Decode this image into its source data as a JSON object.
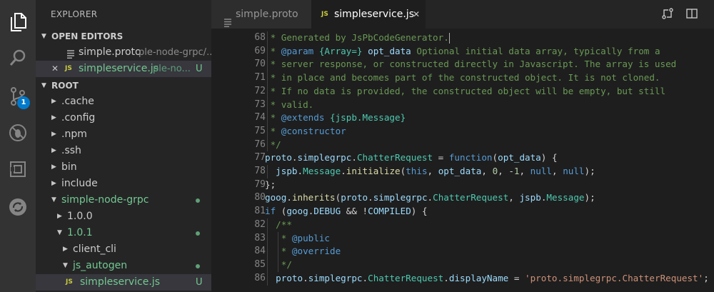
{
  "explorer": {
    "title": "EXPLORER",
    "open_editors": {
      "label": "OPEN EDITORS",
      "items": [
        {
          "name": "simple.proto",
          "path": "ple-node-grpc/..."
        },
        {
          "close": "✕",
          "badge": "JS",
          "name": "simpleservice.js",
          "path": "ple-no...",
          "status": "U"
        }
      ]
    },
    "root": {
      "label": "ROOT",
      "items": [
        {
          "name": ".cache"
        },
        {
          "name": ".config"
        },
        {
          "name": ".npm"
        },
        {
          "name": ".ssh"
        },
        {
          "name": "bin"
        },
        {
          "name": "include"
        },
        {
          "name": "simple-node-grpc"
        },
        {
          "name": "1.0.0"
        },
        {
          "name": "1.0.1"
        },
        {
          "name": "client_cli"
        },
        {
          "name": "js_autogen"
        },
        {
          "badge": "JS",
          "name": "simpleservice.js",
          "status": "U"
        }
      ]
    }
  },
  "activity_bar": {
    "badge_count": "1",
    "icons": [
      "files-icon",
      "search-icon",
      "source-control-icon",
      "debug-icon",
      "extensions-icon",
      "sync-icon"
    ]
  },
  "tabs": [
    {
      "label": "simple.proto",
      "active": false
    },
    {
      "badge": "JS",
      "label": "simpleservice.js",
      "active": true,
      "close": "✕"
    }
  ],
  "editor": {
    "line_numbers": [
      "68",
      "69",
      "70",
      "71",
      "72",
      "73",
      "74",
      "75",
      "76",
      "77",
      "78",
      "79",
      "80",
      "81",
      "82",
      "83",
      "84",
      "85",
      "86"
    ],
    "lines": [
      " * Generated by JsPbCodeGenerator.",
      " * @param {Array=} opt_data Optional initial data array, typically from a",
      " * server response, or constructed directly in Javascript. The array is used",
      " * in place and becomes part of the constructed object. It is not cloned.",
      " * If no data is provided, the constructed object will be empty, but still",
      " * valid.",
      " * @extends {jspb.Message}",
      " * @constructor",
      " */",
      "proto.simplegrpc.ChatterRequest = function(opt_data) {",
      "  jspb.Message.initialize(this, opt_data, 0, -1, null, null);",
      "};",
      "goog.inherits(proto.simplegrpc.ChatterRequest, jspb.Message);",
      "if (goog.DEBUG && !COMPILED) {",
      "  /**",
      "   * @public",
      "   * @override",
      "   */",
      "  proto.simplegrpc.ChatterRequest.displayName = 'proto.simplegrpc.ChatterRequest';"
    ]
  },
  "colors": {
    "activity_bar": "#333333",
    "sidebar": "#252526",
    "editor": "#1e1e1e",
    "accent": "#007acc",
    "untracked": "#73c991",
    "comment": "#6a9955",
    "keyword": "#569cd6",
    "string": "#ce9178"
  }
}
